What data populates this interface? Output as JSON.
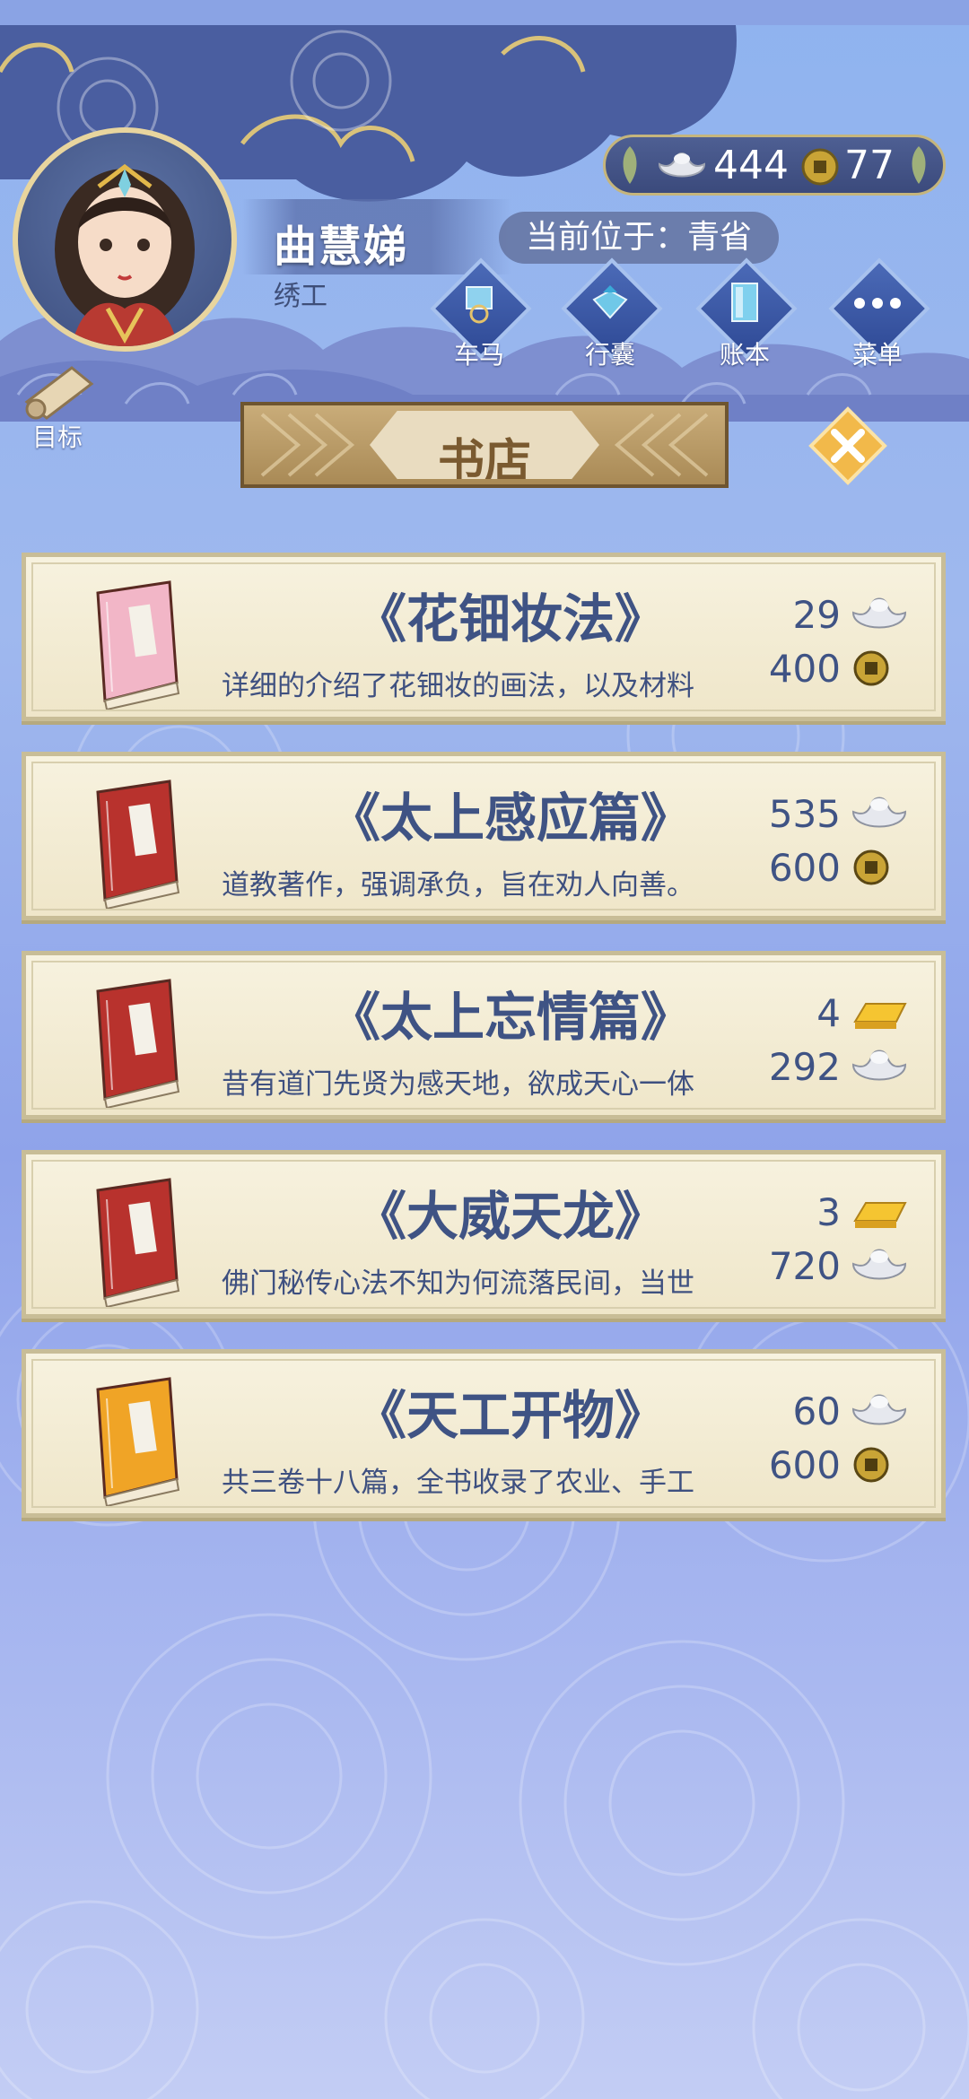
{
  "player": {
    "name": "曲慧娣",
    "job": "绣工",
    "location": "当前位于：青省"
  },
  "currency": {
    "silver": "444",
    "coins": "77"
  },
  "menu": [
    {
      "label": "车马",
      "icon": "carriage-icon"
    },
    {
      "label": "行囊",
      "icon": "bundle-icon"
    },
    {
      "label": "账本",
      "icon": "ledger-icon"
    },
    {
      "label": "菜单",
      "icon": "more-icon"
    }
  ],
  "goal": {
    "label": "目标"
  },
  "shop": {
    "title": "书店"
  },
  "items": [
    {
      "title": "《花钿妆法》",
      "desc": "详细的介绍了花钿妆的画法，以及材料",
      "price1": "29",
      "price1_icon": "silver-ingot-icon",
      "price2": "400",
      "price2_icon": "copper-coin-icon",
      "book_color": "#f2b6c7"
    },
    {
      "title": "《太上感应篇》",
      "desc": "道教著作，强调承负，旨在劝人向善。",
      "price1": "535",
      "price1_icon": "silver-ingot-icon",
      "price2": "600",
      "price2_icon": "copper-coin-icon",
      "book_color": "#b8322d"
    },
    {
      "title": "《太上忘情篇》",
      "desc": "昔有道门先贤为感天地，欲成天心一体",
      "price1": "4",
      "price1_icon": "gold-bar-icon",
      "price2": "292",
      "price2_icon": "silver-ingot-icon",
      "book_color": "#b8322d"
    },
    {
      "title": "《大威天龙》",
      "desc": "佛门秘传心法不知为何流落民间，当世",
      "price1": "3",
      "price1_icon": "gold-bar-icon",
      "price2": "720",
      "price2_icon": "silver-ingot-icon",
      "book_color": "#b8322d"
    },
    {
      "title": "《天工开物》",
      "desc": "共三卷十八篇，全书收录了农业、手工",
      "price1": "60",
      "price1_icon": "silver-ingot-icon",
      "price2": "600",
      "price2_icon": "copper-coin-icon",
      "book_color": "#f0a426"
    }
  ]
}
